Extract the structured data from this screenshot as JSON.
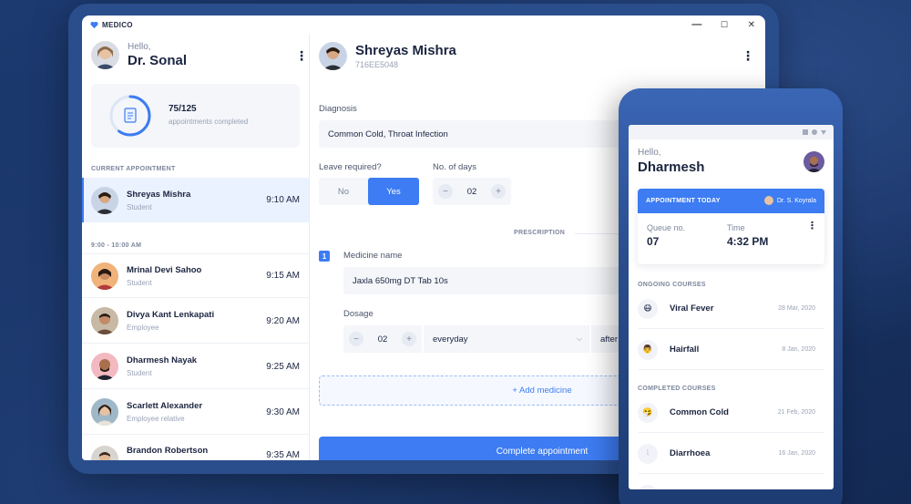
{
  "app": {
    "title": "MEDICO"
  },
  "window_controls": {
    "minimize": "—",
    "maximize": "☐",
    "close": "✕"
  },
  "sidebar": {
    "greeting": "Hello,",
    "doctor_name": "Dr. Sonal",
    "menu_icon": "⋮",
    "progress": {
      "count": "75/125",
      "label": "appointments completed",
      "fraction": 0.6
    },
    "current_label": "CURRENT APPOINTMENT",
    "current": {
      "name": "Shreyas Mishra",
      "role": "Student",
      "time": "9:10 AM"
    },
    "slot_label": "9:00 - 10:00 AM",
    "patients": [
      {
        "name": "Mrinal Devi Sahoo",
        "role": "Student",
        "time": "9:15 AM"
      },
      {
        "name": "Divya Kant Lenkapati",
        "role": "Employee",
        "time": "9:20 AM"
      },
      {
        "name": "Dharmesh Nayak",
        "role": "Student",
        "time": "9:25 AM"
      },
      {
        "name": "Scarlett Alexander",
        "role": "Employee relative",
        "time": "9:30 AM"
      },
      {
        "name": "Brandon Robertson",
        "role": "",
        "time": "9:35 AM"
      }
    ]
  },
  "patient": {
    "name": "Shreyas Mishra",
    "id": "716EE5048",
    "menu_icon": "⋮",
    "diagnosis_label": "Diagnosis",
    "diagnosis": "Common Cold, Throat Infection",
    "leave_label": "Leave required?",
    "leave_no": "No",
    "leave_yes": "Yes",
    "days_label": "No. of days",
    "days": "02",
    "prescription_label": "PRESCRIPTION",
    "medicine_index": "1",
    "medicine_label": "Medicine name",
    "medicine": "Jaxla 650mg DT Tab 10s",
    "dosage_label": "Dosage",
    "dosage_qty": "02",
    "dosage_freq": "everyday",
    "dosage_when": "after",
    "add_medicine": "+ Add medicine",
    "complete": "Complete appointment",
    "minus": "−",
    "plus": "+"
  },
  "phone": {
    "greeting": "Hello,",
    "name": "Dharmesh",
    "appointment_header": "APPOINTMENT TODAY",
    "doctor": "Dr. S. Koyrala",
    "queue_label": "Queue no.",
    "queue": "07",
    "time_label": "Time",
    "time": "4:32 PM",
    "menu_icon": "⋮",
    "ongoing_label": "ONGOING COURSES",
    "ongoing": [
      {
        "name": "Viral Fever",
        "date": "28 Mar, 2020",
        "icon": "😷"
      },
      {
        "name": "Hairfall",
        "date": "8 Jan, 2020",
        "icon": "👨"
      }
    ],
    "completed_label": "COMPLETED COURSES",
    "completed": [
      {
        "name": "Common Cold",
        "date": "21 Feb, 2020",
        "icon": "🤧"
      },
      {
        "name": "Diarrhoea",
        "date": "16 Jan, 2020",
        "icon": ""
      }
    ]
  },
  "colors": {
    "accent": "#3d7cf2",
    "background": "#17305f",
    "text": "#1b2540"
  }
}
